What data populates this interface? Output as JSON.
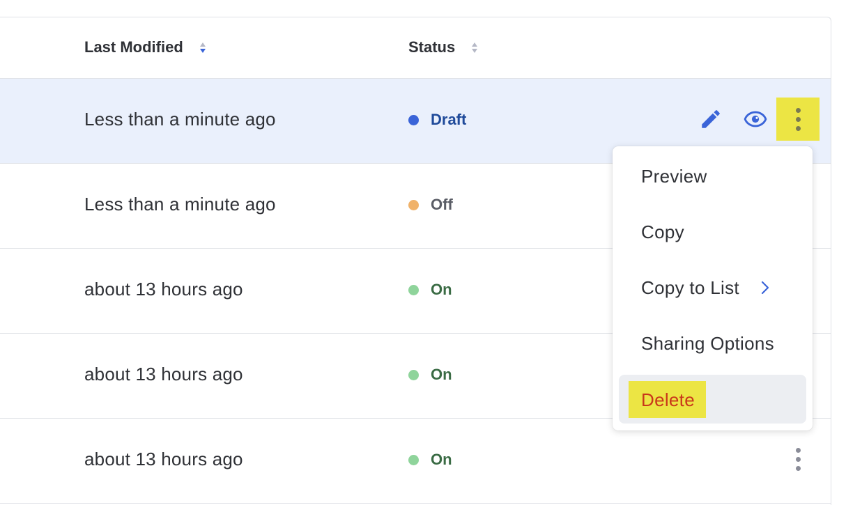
{
  "table": {
    "columns": {
      "last_modified": "Last Modified",
      "status": "Status"
    },
    "rows": [
      {
        "modified": "Less than a minute ago",
        "status": "Draft",
        "status_color": "#3a64d8",
        "status_text_color": "#1f4a9a"
      },
      {
        "modified": "Less than a minute ago",
        "status": "Off",
        "status_color": "#f0b26a",
        "status_text_color": "#5a5d66"
      },
      {
        "modified": "about 13 hours ago",
        "status": "On",
        "status_color": "#8fd49b",
        "status_text_color": "#3a6b44"
      },
      {
        "modified": "about 13 hours ago",
        "status": "On",
        "status_color": "#8fd49b",
        "status_text_color": "#3a6b44"
      },
      {
        "modified": "about 13 hours ago",
        "status": "On",
        "status_color": "#8fd49b",
        "status_text_color": "#3a6b44"
      }
    ]
  },
  "row_actions": {
    "edit_icon": "pencil-icon",
    "preview_icon": "eye-icon",
    "more_icon": "kebab-icon",
    "icon_color": "#3a64d8"
  },
  "context_menu": {
    "items": [
      {
        "label": "Preview"
      },
      {
        "label": "Copy"
      },
      {
        "label": "Copy to List",
        "has_submenu": true,
        "submenu_icon": "chevron-right-icon"
      },
      {
        "label": "Sharing Options"
      },
      {
        "label": "Delete",
        "danger": true
      }
    ],
    "danger_color": "#c9371a",
    "highlight_color": "#ece544"
  }
}
